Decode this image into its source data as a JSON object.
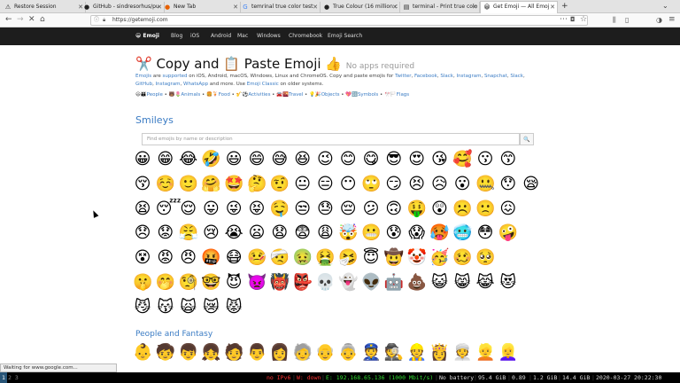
{
  "browser": {
    "tabs": [
      {
        "icon": "",
        "label": "Restore Session"
      },
      {
        "icon": "",
        "label": "GitHub - sindresorhus/pu"
      },
      {
        "icon": "",
        "label": "New Tab"
      },
      {
        "icon": "G",
        "label": "temrinal true color test"
      },
      {
        "icon": "",
        "label": "True Colour (16 million c"
      },
      {
        "icon": "",
        "label": "terminal - Print true colo"
      },
      {
        "icon": "😀",
        "label": "Get Emoji — All Emoj"
      }
    ],
    "url": "https://getemoji.com",
    "status": "Waiting for www.google.com..."
  },
  "site": {
    "logo": "😀 Emoji",
    "nav": [
      "Blog",
      "iOS",
      "Android",
      "Mac",
      "Windows",
      "Chromebook",
      "Emoji Search"
    ],
    "title_p1": "✂️ Copy and ",
    "title_p2": "📋 Paste Emoji 👍",
    "title_sub": "No apps required",
    "desc": {
      "emojis": "Emojis",
      "are": " are ",
      "supported": "supported",
      "mid": " on iOS, Android, macOS, Windows, Linux and ChromeOS. Copy and paste emojis for ",
      "twitter": "Twitter",
      "c1": ", ",
      "facebook": "Facebook",
      "c2": ", ",
      "slack": "Slack",
      "c3": ", ",
      "instagram": "Instagram",
      "c4": ", ",
      "snapchat": "Snapchat",
      "c5": ", ",
      "slack2": "Slack",
      "c6": ", ",
      "github": "GitHub",
      "c7": ", ",
      "instagram2": "Instagram",
      "c8": ", ",
      "whatsapp": "WhatsApp",
      "more": " and more. Use ",
      "classic": "Emoji Classic",
      "older": " on older systems."
    },
    "categories": [
      {
        "icons": "😃👪",
        "label": "People"
      },
      {
        "icons": "🐻🌷",
        "label": "Animals"
      },
      {
        "icons": "🍔🍹",
        "label": "Food"
      },
      {
        "icons": "🎷⚽",
        "label": "Activities"
      },
      {
        "icons": "🚘🌇",
        "label": "Travel"
      },
      {
        "icons": "💡🎉",
        "label": "Objects"
      },
      {
        "icons": "💖🔣",
        "label": "Symbols"
      },
      {
        "icons": "🎌🏳️",
        "label": "Flags"
      }
    ],
    "section_smileys": "Smileys",
    "search_placeholder": "Find emojis by name or description",
    "search_icon": "🔍",
    "section_people": "People and Fantasy"
  },
  "emoji_rows": [
    [
      "😀",
      "😁",
      "😂",
      "🤣",
      "😃",
      "😄",
      "😅",
      "😆",
      "😉",
      "😊",
      "😋",
      "😎",
      "😍",
      "😘",
      "🥰",
      "😗",
      "😙"
    ],
    [
      "😚",
      "☺️",
      "🙂",
      "🤗",
      "🤩",
      "🤔",
      "🤨",
      "😐",
      "😑",
      "😶",
      "🙄",
      "😏",
      "😣",
      "😥",
      "😮",
      "🤐",
      "😯",
      "😪"
    ],
    [
      "😫",
      "😴",
      "😌",
      "😛",
      "😜",
      "😝",
      "🤤",
      "😒",
      "😓",
      "😔",
      "😕",
      "🙃",
      "🤑",
      "😲",
      "☹️",
      "🙁",
      "😖"
    ],
    [
      "😞",
      "😟",
      "😤",
      "😢",
      "😭",
      "😦",
      "😧",
      "😨",
      "😩",
      "🤯",
      "😬",
      "😰",
      "😱",
      "🥵",
      "🥶",
      "😳",
      "🤪"
    ],
    [
      "😵",
      "😡",
      "😠",
      "🤬",
      "😷",
      "🤒",
      "🤕",
      "🤢",
      "🤮",
      "🤧",
      "😇",
      "🤠",
      "🤡",
      "🥳",
      "🥴",
      "🥺"
    ],
    [
      "🤫",
      "🤭",
      "🧐",
      "🤓",
      "😈",
      "👿",
      "👹",
      "👺",
      "💀",
      "👻",
      "👽",
      "🤖",
      "💩",
      "😺",
      "😸",
      "😹",
      "😻"
    ],
    [
      "😼",
      "😽",
      "🙀",
      "😿",
      "😾"
    ]
  ],
  "people_row": [
    "👶",
    "🧒",
    "👦",
    "👧",
    "🧑",
    "👨",
    "👩",
    "🧓",
    "👴",
    "👵",
    "👮",
    "🕵️",
    "👷",
    "👸",
    "👳",
    "👱",
    "👱‍♀️"
  ],
  "statusbar": {
    "workspace1": "1",
    "workspace2": "2 3",
    "ipv6": "no IPv6",
    "wifi": "W: down",
    "eth": "E: 192.168.65.136 (1000 Mbit/s)",
    "battery": "No battery",
    "disk": "95.4 GiB",
    "load": "0.89",
    "mem": "1.2 GiB",
    "swap": "14.4 GiB",
    "clock": "2020-03-27 20:22:30"
  },
  "colors": {
    "link": "#3b7cc4",
    "site_nav_bg": "#1d1d1d",
    "bar_red": "#ff3333",
    "bar_green": "#33dd33"
  }
}
